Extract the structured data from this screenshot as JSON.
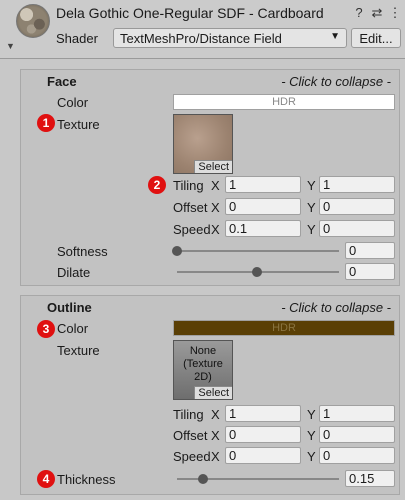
{
  "header": {
    "title": "Dela Gothic One-Regular SDF - Cardboard",
    "shader_label": "Shader",
    "shader_value": "TextMeshPro/Distance Field",
    "edit_label": "Edit..."
  },
  "face": {
    "title": "Face",
    "collapse": "- Click to collapse -",
    "color_label": "Color",
    "color_value": "HDR",
    "color_hex": "#ffffff",
    "texture_label": "Texture",
    "texture_select": "Select",
    "tiling_label": "Tiling",
    "tiling_x": "1",
    "tiling_y": "1",
    "offset_label": "Offset",
    "offset_x": "0",
    "offset_y": "0",
    "speed_label": "Speed",
    "speed_x": "0.1",
    "speed_y": "0",
    "softness_label": "Softness",
    "softness_value": "0",
    "dilate_label": "Dilate",
    "dilate_value": "0"
  },
  "outline": {
    "title": "Outline",
    "collapse": "- Click to collapse -",
    "color_label": "Color",
    "color_value": "HDR",
    "color_hex": "#5a3f05",
    "texture_label": "Texture",
    "texture_none": "None\n(Texture\n2D)",
    "texture_select": "Select",
    "tiling_label": "Tiling",
    "tiling_x": "1",
    "tiling_y": "1",
    "offset_label": "Offset",
    "offset_x": "0",
    "offset_y": "0",
    "speed_label": "Speed",
    "speed_x": "0",
    "speed_y": "0",
    "thickness_label": "Thickness",
    "thickness_value": "0.15"
  },
  "axis": {
    "x": "X",
    "y": "Y"
  },
  "badges": [
    "1",
    "2",
    "3",
    "4"
  ]
}
